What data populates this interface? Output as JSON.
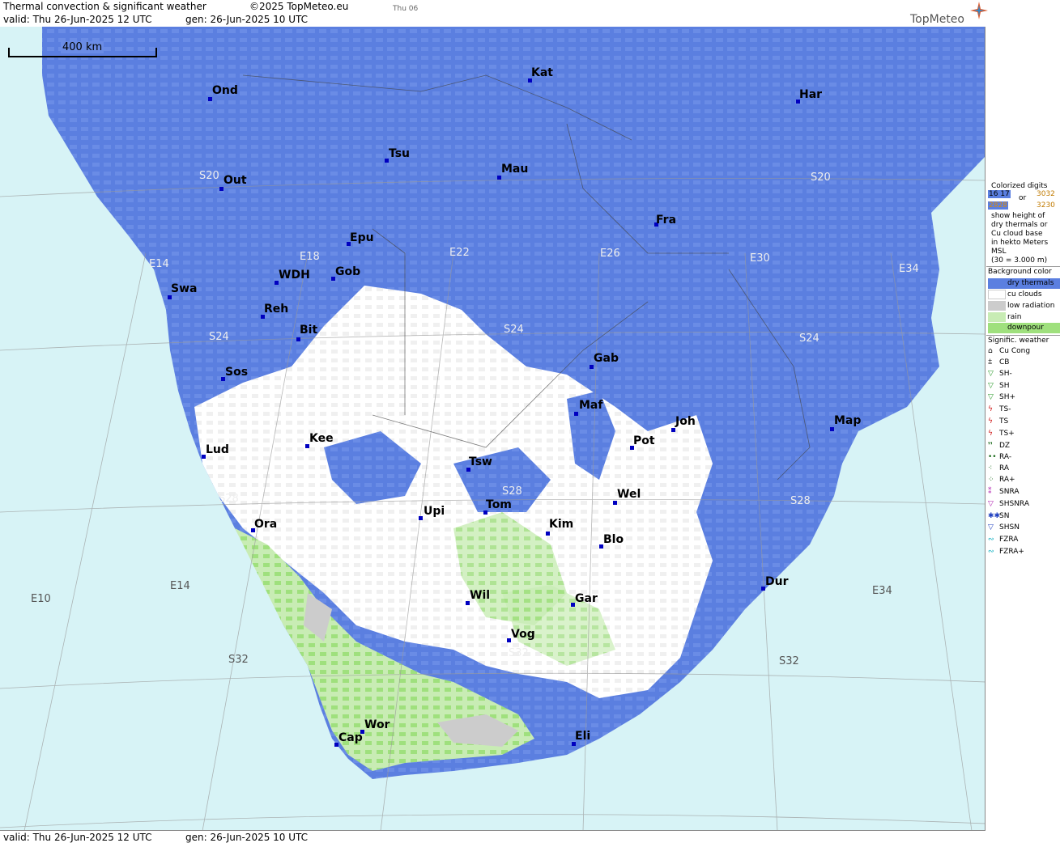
{
  "header": {
    "title": "Thermal convection & significant weather",
    "copyright": "©2025 TopMeteo.eu",
    "day": "Thu 06",
    "valid": "valid:  Thu   26-Jun-2025  12 UTC",
    "gen": "gen:  26-Jun-2025 10 UTC"
  },
  "footer": {
    "valid": "valid:  Thu   26-Jun-2025  12 UTC",
    "gen": "gen:  26-Jun-2025 10 UTC"
  },
  "logo": {
    "text": "TopMeteo",
    "icon": "compass-star-icon"
  },
  "scale": {
    "label": "400 km"
  },
  "colors": {
    "dry_thermals": "#5b7fe0",
    "cu_clouds": "#ffffff",
    "low_radiation": "#cccccc",
    "rain": "#c8ecb4",
    "downpour": "#9fe07d",
    "sea": "#d7f3f6"
  },
  "cities": [
    {
      "id": "ond",
      "name": "Ond"
    },
    {
      "id": "kat",
      "name": "Kat"
    },
    {
      "id": "har",
      "name": "Har"
    },
    {
      "id": "tsu",
      "name": "Tsu"
    },
    {
      "id": "out",
      "name": "Out"
    },
    {
      "id": "mau",
      "name": "Mau"
    },
    {
      "id": "fra",
      "name": "Fra"
    },
    {
      "id": "epu",
      "name": "Epu"
    },
    {
      "id": "swa",
      "name": "Swa"
    },
    {
      "id": "wdh",
      "name": "WDH"
    },
    {
      "id": "gob",
      "name": "Gob"
    },
    {
      "id": "reh",
      "name": "Reh"
    },
    {
      "id": "bit",
      "name": "Bit"
    },
    {
      "id": "gab",
      "name": "Gab"
    },
    {
      "id": "sos",
      "name": "Sos"
    },
    {
      "id": "maf",
      "name": "Maf"
    },
    {
      "id": "joh",
      "name": "Joh"
    },
    {
      "id": "map",
      "name": "Map"
    },
    {
      "id": "kee",
      "name": "Kee"
    },
    {
      "id": "pot",
      "name": "Pot"
    },
    {
      "id": "lud",
      "name": "Lud"
    },
    {
      "id": "tsw",
      "name": "Tsw"
    },
    {
      "id": "wel",
      "name": "Wel"
    },
    {
      "id": "upi",
      "name": "Upi"
    },
    {
      "id": "tom",
      "name": "Tom"
    },
    {
      "id": "kim",
      "name": "Kim"
    },
    {
      "id": "ora",
      "name": "Ora"
    },
    {
      "id": "blo",
      "name": "Blo"
    },
    {
      "id": "dur",
      "name": "Dur"
    },
    {
      "id": "wil",
      "name": "Wil"
    },
    {
      "id": "gar",
      "name": "Gar"
    },
    {
      "id": "vog",
      "name": "Vog"
    },
    {
      "id": "wor",
      "name": "Wor"
    },
    {
      "id": "cap",
      "name": "Cap"
    },
    {
      "id": "eli",
      "name": "Eli"
    }
  ],
  "gridlabels": [
    "E14",
    "E18",
    "E22",
    "E26",
    "E30",
    "E34",
    "S20",
    "S20",
    "S24",
    "S24",
    "S24",
    "S28",
    "S28",
    "S28",
    "E14",
    "E10",
    "E34",
    "S32",
    "S32",
    "S32"
  ],
  "legend": {
    "digits_title": "Colorized digits",
    "digits_ex1": "16 17",
    "digits_or": "or",
    "digits_ex2": "3032",
    "digits_ex3": "2828",
    "digits_ex4": "3230",
    "digits_desc": [
      "show height of",
      "dry thermals or",
      "Cu cloud base",
      "in hekto Meters",
      "MSL",
      "(30 = 3.000 m)"
    ],
    "bg_title": "Background color",
    "bg_items": [
      "dry thermals",
      "cu clouds",
      "low radiation",
      "rain",
      "downpour"
    ],
    "wx_title": "Signific. weather",
    "wx_items": [
      "Cu Cong",
      "CB",
      "SH-",
      "SH",
      "SH+",
      "TS-",
      "TS",
      "TS+",
      "DZ",
      "RA-",
      "RA",
      "RA+",
      "SNRA",
      "SHSNRA",
      "SN",
      "SHSN",
      "FZRA",
      "FZRA+"
    ]
  }
}
